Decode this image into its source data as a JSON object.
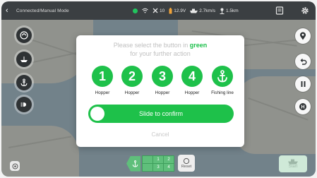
{
  "topbar": {
    "back_icon": "chevron-left-icon",
    "mode": "Connected/Manual Mode",
    "status_color": "#22c55e",
    "satellites": "10",
    "voltage": "12.9V",
    "speed": "2.7km/s",
    "distance": "1.5km",
    "icons": [
      "wifi-icon",
      "satellite-icon",
      "battery-icon",
      "boat-icon",
      "distance-icon",
      "book-icon",
      "gear-icon"
    ]
  },
  "left_buttons": [
    "radar-icon",
    "boat-icon",
    "anchor-icon",
    "light-icon"
  ],
  "right_buttons": [
    "location-icon",
    "return-icon",
    "pause-icon",
    "home-icon"
  ],
  "bottom": {
    "hopper_cells": [
      "1",
      "2",
      "3",
      "4"
    ],
    "reset_label": "Reset",
    "start_label": "Start"
  },
  "modal": {
    "title_prefix": "Please select the button in ",
    "title_highlight": "green",
    "title_suffix": "for your further action",
    "accent": "#1ec14a",
    "options": [
      {
        "number": "1",
        "label": "Hopper"
      },
      {
        "number": "2",
        "label": "Hopper"
      },
      {
        "number": "3",
        "label": "Hopper"
      },
      {
        "number": "4",
        "label": "Hopper"
      },
      {
        "icon": "anchor-icon",
        "label": "Fishing line"
      }
    ],
    "slider_label": "Slide to confirm",
    "cancel_label": "Cancel"
  }
}
